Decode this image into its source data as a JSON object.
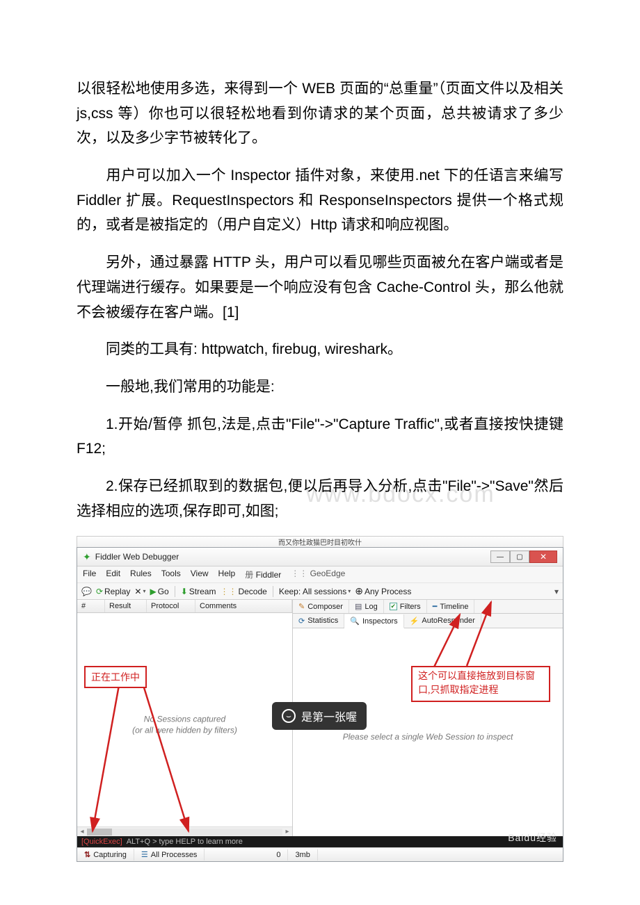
{
  "paragraphs": {
    "p1": "以很轻松地使用多选，来得到一个 WEB 页面的“总重量”（页面文件以及相关 js,css 等）你也可以很轻松地看到你请求的某个页面，总共被请求了多少次，以及多少字节被转化了。",
    "p2": "用户可以加入一个 Inspector 插件对象，来使用.net 下的任语言来编写 Fiddler 扩展。RequestInspectors 和 ResponseInspectors 提供一个格式规的，或者是被指定的（用户自定义）Http 请求和响应视图。",
    "p3": "另外，通过暴露 HTTP 头，用户可以看见哪些页面被允在客户端或者是代理端进行缓存。如果要是一个响应没有包含 Cache-Control 头，那么他就不会被缓存在客户端。[1]",
    "p4": "同类的工具有: httpwatch, firebug, wireshark。",
    "p5": "一般地,我们常用的功能是:",
    "p6": "1.开始/暂停 抓包,法是,点击\"File\"->\"Capture Traffic\",或者直接按快捷键 F12;",
    "p7": "2.保存已经抓取到的数据包,便以后再导入分析,点击\"File\"->\"Save\"然后选择相应的选项,保存即可,如图;"
  },
  "watermark": "www.bdocx.com",
  "app": {
    "topbar": "而又你牡政猫巴时目初吹什",
    "title": "Fiddler Web Debugger"
  },
  "menu": {
    "file": "File",
    "edit": "Edit",
    "rules": "Rules",
    "tools": "Tools",
    "view": "View",
    "help": "Help",
    "del": "Fiddler",
    "geo": "GeoEdge"
  },
  "toolbar": {
    "replay": "Replay",
    "go": "Go",
    "stream": "Stream",
    "decode": "Decode",
    "keep": "Keep: All sessions",
    "any": "Any Process"
  },
  "gridhead": {
    "num": "#",
    "result": "Result",
    "proto": "Protocol",
    "comments": "Comments"
  },
  "nosessions": {
    "l1": "No Sessions captured",
    "l2": "(or all were hidden by filters)"
  },
  "rtabs": {
    "composer": "Composer",
    "log": "Log",
    "filters": "Filters",
    "timeline": "Timeline",
    "stats": "Statistics",
    "inspectors": "Inspectors",
    "autoresp": "AutoResponder"
  },
  "inspect_msg": "Please select a single Web Session to inspect",
  "quickexec": {
    "left": "[QuickExec]",
    "hint": "ALT+Q > type HELP to learn more"
  },
  "status": {
    "capturing": "Capturing",
    "allproc": "All Processes",
    "count": "0",
    "mem": "3mb"
  },
  "callouts": {
    "left": "正在工作中",
    "right": "这个可以直接拖放到目标窗口,只抓取指定进程"
  },
  "tooltip": "是第一张喔",
  "baidu": "Baidu经验"
}
